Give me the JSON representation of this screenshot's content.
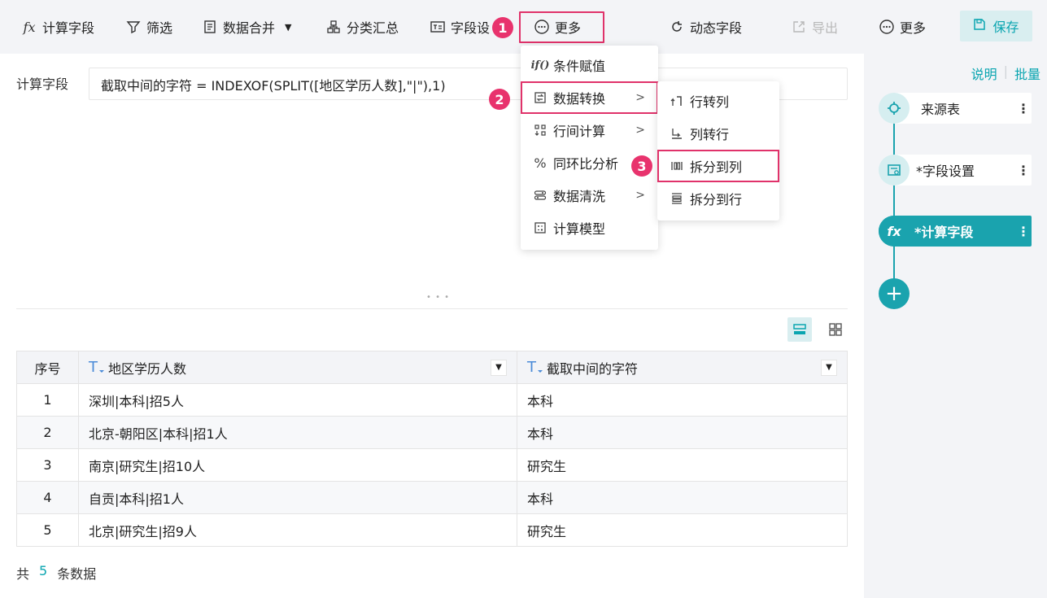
{
  "toolbar": {
    "calc_field": "计算字段",
    "filter": "筛选",
    "merge": "数据合并",
    "group_summary": "分类汇总",
    "field_settings": "字段设",
    "more_active": "更多",
    "dynamic_field": "动态字段",
    "export": "导出",
    "more": "更多",
    "save": "保存"
  },
  "steps": [
    "1",
    "2",
    "3"
  ],
  "formula": {
    "label": "计算字段",
    "value": "截取中间的字符 = INDEXOF(SPLIT([地区学历人数],\"|\"),1)"
  },
  "more_menu": {
    "items": [
      {
        "label": "条件赋值",
        "icon": "if-icon"
      },
      {
        "label": "数据转换",
        "icon": "transform-icon",
        "submenu": true
      },
      {
        "label": "行间计算",
        "icon": "row-calc-icon",
        "submenu": true
      },
      {
        "label": "同环比分析",
        "icon": "percent-icon"
      },
      {
        "label": "数据清洗",
        "icon": "clean-icon",
        "submenu": true
      },
      {
        "label": "计算模型",
        "icon": "model-icon"
      }
    ]
  },
  "transform_menu": {
    "items": [
      {
        "label": "行转列",
        "icon": "row-to-col-icon"
      },
      {
        "label": "列转行",
        "icon": "col-to-row-icon"
      },
      {
        "label": "拆分到列",
        "icon": "split-col-icon"
      },
      {
        "label": "拆分到行",
        "icon": "split-row-icon"
      }
    ]
  },
  "table": {
    "headers": [
      "序号",
      "地区学历人数",
      "截取中间的字符"
    ],
    "type_glyph": "T",
    "rows": [
      [
        "1",
        "深圳|本科|招5人",
        "本科"
      ],
      [
        "2",
        "北京-朝阳区|本科|招1人",
        "本科"
      ],
      [
        "3",
        "南京|研究生|招10人",
        "研究生"
      ],
      [
        "4",
        "自贡|本科|招1人",
        "本科"
      ],
      [
        "5",
        "北京|研究生|招9人",
        "研究生"
      ]
    ]
  },
  "footer": {
    "prefix": "共",
    "count": "5",
    "suffix": "条数据"
  },
  "right_panel": {
    "help": "说明",
    "batch": "批量",
    "nodes": [
      "来源表",
      "*字段设置",
      "*计算字段"
    ],
    "fx": "fx",
    "add": "+"
  },
  "colors": {
    "accent": "#1aa3ae",
    "highlight": "#e0326a",
    "badge": "#e8336d"
  }
}
